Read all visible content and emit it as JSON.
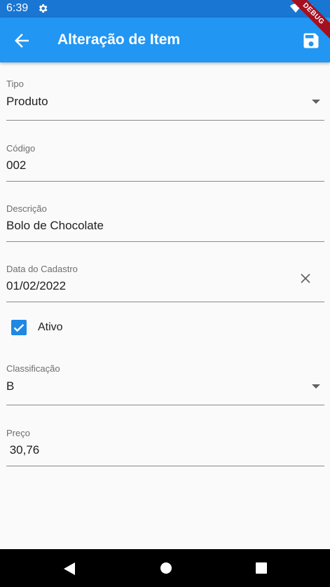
{
  "status_bar": {
    "time": "6:39"
  },
  "app_bar": {
    "title": "Alteração de Item",
    "debug_label": "DEBUG"
  },
  "form": {
    "tipo": {
      "label": "Tipo",
      "value": "Produto"
    },
    "codigo": {
      "label": "Código",
      "value": "002"
    },
    "descricao": {
      "label": "Descrição",
      "value": "Bolo de Chocolate"
    },
    "data_cadastro": {
      "label": "Data do Cadastro",
      "value": "01/02/2022"
    },
    "ativo": {
      "label": "Ativo",
      "checked": true
    },
    "classificacao": {
      "label": "Classificação",
      "value": "B"
    },
    "preco": {
      "label": "Preço",
      "value": " 30,76"
    }
  },
  "colors": {
    "primary": "#2196f3",
    "primary_dark": "#1976d2",
    "checkbox": "#1e88e5",
    "debug_banner": "#a5101f"
  },
  "icons": [
    "gear-icon",
    "wifi-icon",
    "signal-icon",
    "back-arrow-icon",
    "save-icon",
    "dropdown-arrow-icon",
    "clear-icon",
    "check-icon",
    "nav-back-icon",
    "nav-home-icon",
    "nav-recent-icon"
  ]
}
